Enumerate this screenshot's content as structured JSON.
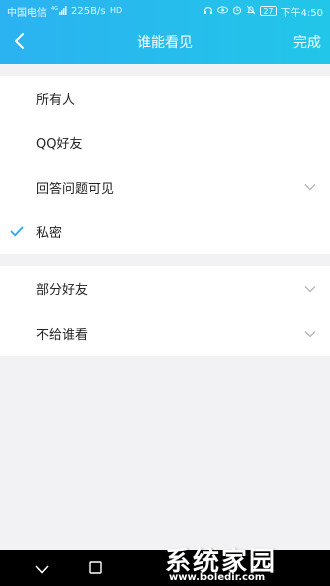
{
  "status_bar": {
    "carrier": "中国电信",
    "network": "4G",
    "speed": "225B/s",
    "hd_label": "HD",
    "battery": "27",
    "time": "下午4:50"
  },
  "header": {
    "title": "谁能看见",
    "done_label": "完成"
  },
  "options_group1": [
    {
      "label": "所有人",
      "checked": false,
      "expandable": false
    },
    {
      "label": "QQ好友",
      "checked": false,
      "expandable": false
    },
    {
      "label": "回答问题可见",
      "checked": false,
      "expandable": true
    },
    {
      "label": "私密",
      "checked": true,
      "expandable": false
    }
  ],
  "options_group2": [
    {
      "label": "部分好友",
      "expandable": true
    },
    {
      "label": "不给谁看",
      "expandable": true
    }
  ],
  "colors": {
    "accent": "#2bb2f1",
    "check": "#2aa9ef",
    "background": "#f2f2f4"
  },
  "watermark": {
    "title": "系统家园",
    "url": "www.boledir.com"
  }
}
